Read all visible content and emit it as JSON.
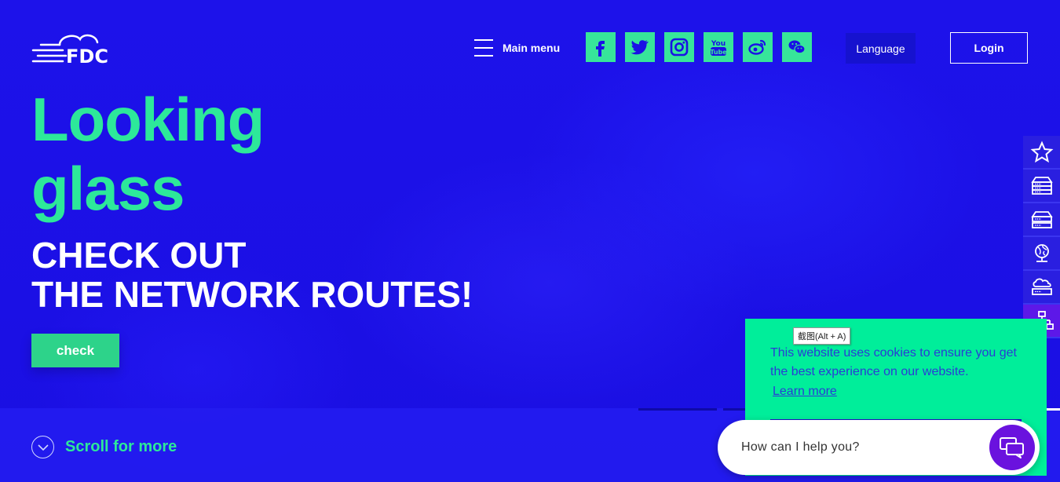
{
  "header": {
    "logo_text": "FDC",
    "main_menu_label": "Main menu",
    "socials": [
      {
        "icon": "facebook-icon"
      },
      {
        "icon": "twitter-icon"
      },
      {
        "icon": "instagram-icon"
      },
      {
        "icon": "youtube-icon",
        "text_top": "You",
        "text_bottom": "Tube"
      },
      {
        "icon": "weibo-icon"
      },
      {
        "icon": "wechat-icon"
      }
    ],
    "language_label": "Language",
    "login_label": "Login"
  },
  "hero": {
    "headline_line1": "Looking",
    "headline_line2": "glass",
    "subhead_line1": "CHECK OUT",
    "subhead_line2": "THE NETWORK ROUTES!",
    "check_label": "check",
    "scroll_label": "Scroll for more"
  },
  "side_rail": {
    "items": [
      "star-icon",
      "server-icon",
      "server-stack-icon",
      "globe-network-icon",
      "cloud-server-icon",
      "network-tree-icon"
    ]
  },
  "cookie_banner": {
    "text": "This website uses cookies to ensure you get the best experience on our website.",
    "learn_more": "Learn more"
  },
  "tooltip": {
    "text": "截图(Alt + A)"
  },
  "chat": {
    "placeholder": "How can I help you?"
  },
  "colors": {
    "background": "#1a10e6",
    "accent_green": "#2de89a",
    "cookie_bg": "#00ee9a",
    "chat_button": "#6a12de"
  }
}
